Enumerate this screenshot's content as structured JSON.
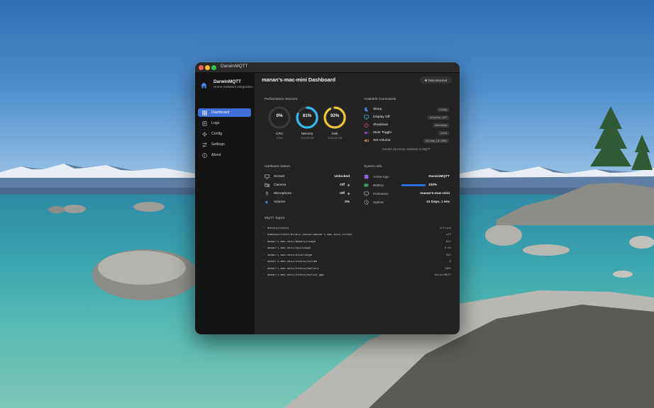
{
  "window": {
    "title": "DarwinMQTT"
  },
  "sidebar": {
    "app_name": "DarwinMQTT",
    "app_subtitle": "Home Assistant Integration",
    "items": [
      {
        "label": "Dashboard",
        "icon": "dashboard-icon",
        "active": true
      },
      {
        "label": "Logs",
        "icon": "logs-icon",
        "active": false
      },
      {
        "label": "Config",
        "icon": "config-icon",
        "active": false
      },
      {
        "label": "Settings",
        "icon": "settings-icon",
        "active": false
      },
      {
        "label": "About",
        "icon": "info-icon",
        "active": false
      }
    ]
  },
  "header": {
    "title": "manan's-mac-mini Dashboard",
    "status": "Disconnected"
  },
  "performance": {
    "title": "Performance Sensors",
    "gauges": [
      {
        "value": "0%",
        "label": "CPU",
        "sub": "0.0%",
        "fraction": 0.0,
        "color": "#555555"
      },
      {
        "value": "81%",
        "label": "Memory",
        "sub": "13.0/16 GB",
        "fraction": 0.81,
        "color": "#36b9f2"
      },
      {
        "value": "92%",
        "label": "Disk",
        "sub": "213/228 GB",
        "fraction": 0.92,
        "color": "#f2c53a"
      }
    ]
  },
  "commands": {
    "title": "Available Commands",
    "items": [
      {
        "label": "Sleep",
        "code": "sleep",
        "icon": "moon-icon",
        "color": "#4a7be6"
      },
      {
        "label": "Display Off",
        "code": "display_off",
        "icon": "display-icon",
        "color": "#4ab7e6"
      },
      {
        "label": "Shutdown",
        "code": "shutdown",
        "icon": "power-icon",
        "color": "#e64a4a"
      },
      {
        "label": "Mute Toggle",
        "code": "mute",
        "icon": "mute-icon",
        "color": "#b04ae6"
      },
      {
        "label": "Set Volume",
        "code": "volume_[0-100]",
        "icon": "volume-icon",
        "color": "#e6944a"
      }
    ],
    "note": "Control via Home Assistant or MQTT"
  },
  "hardware": {
    "title": "Hardware Status",
    "items": [
      {
        "label": "Screen",
        "value": "Unlocked",
        "icon": "screen-icon",
        "dot": false
      },
      {
        "label": "Camera",
        "value": "Off",
        "icon": "camera-icon",
        "dot": true
      },
      {
        "label": "Microphone",
        "value": "Off",
        "icon": "microphone-icon",
        "dot": true
      },
      {
        "label": "Volume",
        "value": "0%",
        "icon": "speaker-icon",
        "dot": false
      }
    ]
  },
  "system": {
    "title": "System Info",
    "items": [
      {
        "label": "Active App:",
        "value": "DarwinMQTT",
        "icon": "app-icon",
        "color": "#9a5ae6"
      },
      {
        "label": "Battery:",
        "value": "100%",
        "icon": "battery-icon",
        "color": "#4ac26a",
        "fraction": 1.0
      },
      {
        "label": "Hostname:",
        "value": "manan's-mac-mini",
        "icon": "desktop-icon",
        "color": "#aaaaaa"
      },
      {
        "label": "Uptime:",
        "value": "41 Days, 1 Hrs",
        "icon": "clock-icon",
        "color": "#aaaaaa"
      }
    ]
  },
  "mqtt": {
    "title": "MQTT Topics",
    "topics": [
      {
        "topic": "darwin/status",
        "value": "offline"
      },
      {
        "topic": "homeassistant/binary_sensor/manan's-mac-mini_screen",
        "value": "off"
      },
      {
        "topic": "manan's-mac-mini/memory/usage",
        "value": "81%"
      },
      {
        "topic": "manan's-mac-mini/cpu/usage",
        "value": "0.0%"
      },
      {
        "topic": "manan's-mac-mini/disk/usage",
        "value": "92%"
      },
      {
        "topic": "manan's-mac-mini/status/volume",
        "value": "0"
      },
      {
        "topic": "manan's-mac-mini/status/battery",
        "value": "100%"
      },
      {
        "topic": "manan's-mac-mini/status/active_app",
        "value": "DarwinMQTT"
      }
    ]
  }
}
